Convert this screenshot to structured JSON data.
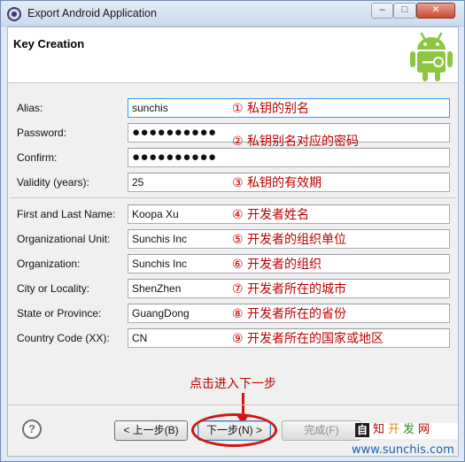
{
  "window": {
    "title": "Export Android Application",
    "controls": {
      "minimize": "–",
      "maximize": "□",
      "close": "✕"
    }
  },
  "header": {
    "title": "Key Creation",
    "logo": "android-robot-icon"
  },
  "fields": [
    {
      "label": "Alias:",
      "value": "sunchis",
      "note": "① 私钥的别名"
    },
    {
      "label": "Password:",
      "value": "●●●●●●●●●●",
      "note": "② 私钥别名对应的密码"
    },
    {
      "label": "Confirm:",
      "value": "●●●●●●●●●●",
      "note": ""
    },
    {
      "label": "Validity (years):",
      "value": "25",
      "note": "③ 私钥的有效期"
    },
    {
      "label": "First and Last Name:",
      "value": "Koopa Xu",
      "note": "④ 开发者姓名"
    },
    {
      "label": "Organizational Unit:",
      "value": "Sunchis Inc",
      "note": "⑤ 开发者的组织单位"
    },
    {
      "label": "Organization:",
      "value": "Sunchis Inc",
      "note": "⑥ 开发者的组织"
    },
    {
      "label": "City or Locality:",
      "value": "ShenZhen",
      "note": "⑦ 开发者所在的城市"
    },
    {
      "label": "State or Province:",
      "value": "GuangDong",
      "note": "⑧ 开发者所在的省份"
    },
    {
      "label": "Country Code (XX):",
      "value": "CN",
      "note": "⑨ 开发者所在的国家或地区"
    }
  ],
  "annotation": "点击进入下一步",
  "buttons": {
    "help": "?",
    "back": "< 上一步(B)",
    "next": "下一步(N) >",
    "finish": "完成(F)"
  },
  "watermark": {
    "box_char": "自",
    "chars": [
      "知",
      "开",
      "发",
      "网"
    ],
    "url": "www.sunchis.com"
  }
}
